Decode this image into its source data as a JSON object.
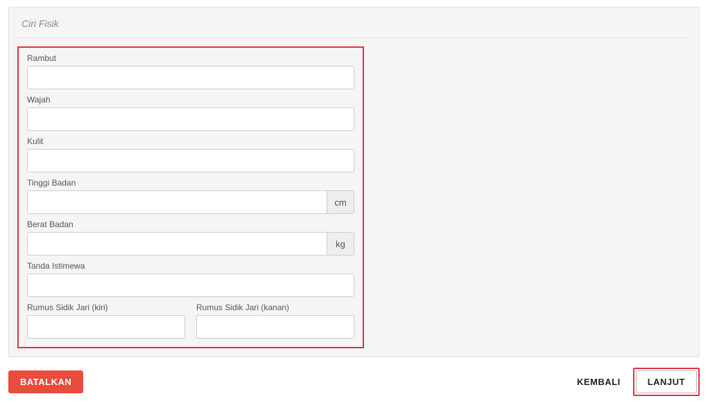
{
  "panel": {
    "title": "Ciri Fisik"
  },
  "form": {
    "rambut": {
      "label": "Rambut",
      "value": ""
    },
    "wajah": {
      "label": "Wajah",
      "value": ""
    },
    "kulit": {
      "label": "Kulit",
      "value": ""
    },
    "tinggi_badan": {
      "label": "Tinggi Badan",
      "value": "",
      "unit": "cm"
    },
    "berat_badan": {
      "label": "Berat Badan",
      "value": "",
      "unit": "kg"
    },
    "tanda_istimewa": {
      "label": "Tanda Istimewa",
      "value": ""
    },
    "sidik_kiri": {
      "label": "Rumus Sidik Jari (kiri)",
      "value": ""
    },
    "sidik_kanan": {
      "label": "Rumus Sidik Jari (kanan)",
      "value": ""
    }
  },
  "actions": {
    "batalkan": "BATALKAN",
    "kembali": "KEMBALI",
    "lanjut": "LANJUT"
  }
}
